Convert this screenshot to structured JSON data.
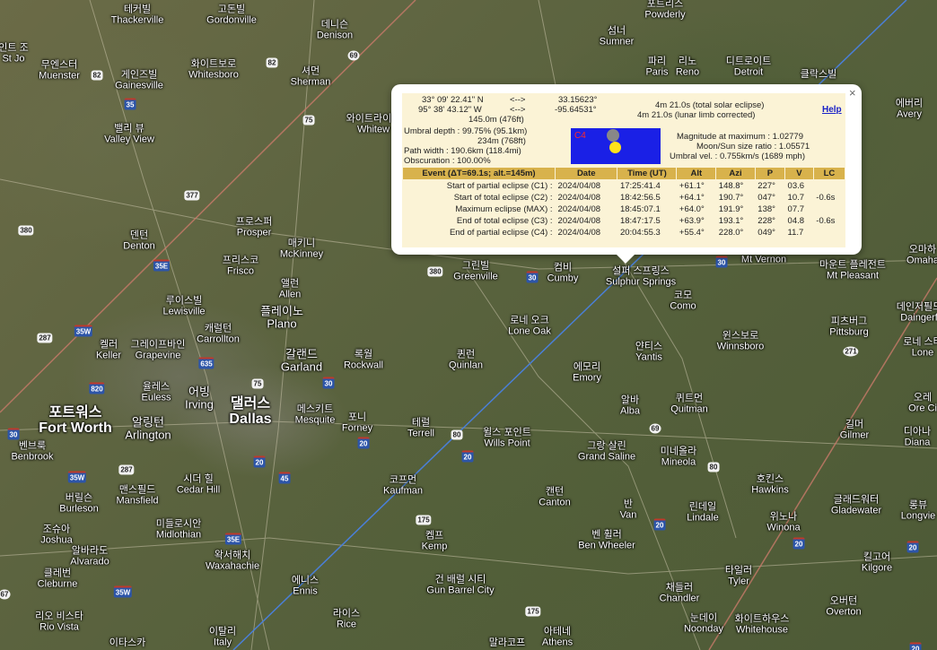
{
  "popup": {
    "coord_lat_dms": "33° 09' 22.41\" N",
    "coord_lon_dms": "95° 38' 43.12\" W",
    "arrow": "<-->",
    "coord_lat_dec": "33.15623°",
    "coord_lon_dec": "-95.64531°",
    "elevation": "145.0m (476ft)",
    "duration_total": "4m 21.0s (total solar eclipse)",
    "duration_limb": "4m 21.0s (lunar limb corrected)",
    "help": "Help",
    "umbral_depth": "Umbral depth : 99.75% (95.1km)",
    "umbral_depth_ft": "234m (768ft)",
    "path_width": "Path width : 190.6km (118.4mi)",
    "obscuration": "Obscuration : 100.00%",
    "sim_label": "C4",
    "magnitude": "Magnitude at maximum : 1.02779",
    "size_ratio": "Moon/Sun size ratio : 1.05571",
    "umbral_vel": "Umbral vel. : 0.755km/s (1689 mph)",
    "close": "×",
    "table": {
      "headers": [
        "Event (ΔT=69.1s; alt.=145m)",
        "Date",
        "Time (UT)",
        "Alt",
        "Azi",
        "P",
        "V",
        "LC"
      ],
      "rows": [
        [
          "Start of partial eclipse (C1) :",
          "2024/04/08",
          "17:25:41.4",
          "+61.1°",
          "148.8°",
          "227°",
          "03.6",
          ""
        ],
        [
          "Start of total eclipse (C2) :",
          "2024/04/08",
          "18:42:56.5",
          "+64.1°",
          "190.7°",
          "047°",
          "10.7",
          "-0.6s"
        ],
        [
          "Maximum eclipse (MAX) :",
          "2024/04/08",
          "18:45:07.1",
          "+64.0°",
          "191.9°",
          "138°",
          "07.7",
          ""
        ],
        [
          "End of total eclipse (C3) :",
          "2024/04/08",
          "18:47:17.5",
          "+63.9°",
          "193.1°",
          "228°",
          "04.8",
          "-0.6s"
        ],
        [
          "End of partial eclipse (C4) :",
          "2024/04/08",
          "20:04:55.3",
          "+55.4°",
          "228.0°",
          "049°",
          "11.7",
          ""
        ]
      ]
    }
  },
  "cities": [
    {
      "ko": "테커빌",
      "en": "Thackerville"
    },
    {
      "ko": "고돈빌",
      "en": "Gordonville"
    },
    {
      "ko": "데니슨",
      "en": "Denison"
    },
    {
      "ko": "포트리스",
      "en": "Powderly"
    },
    {
      "ko": "섬너",
      "en": "Sumner"
    },
    {
      "ko": "인트 조",
      "en": "St Jo"
    },
    {
      "ko": "무엔스터",
      "en": "Muenster"
    },
    {
      "ko": "게인즈빌",
      "en": "Gainesville"
    },
    {
      "ko": "화이트보로",
      "en": "Whitesboro"
    },
    {
      "ko": "셔먼",
      "en": "Sherman"
    },
    {
      "ko": "파리",
      "en": "Paris"
    },
    {
      "ko": "리노",
      "en": "Reno"
    },
    {
      "ko": "디트로이트",
      "en": "Detroit"
    },
    {
      "ko": "클락스빌",
      "en": ""
    },
    {
      "ko": "밸리 뷰",
      "en": "Valley View"
    },
    {
      "ko": "와이트라이트",
      "en": "Whitew"
    },
    {
      "ko": "에버리",
      "en": "Avery"
    },
    {
      "ko": "프로스퍼",
      "en": "Prosper"
    },
    {
      "ko": "덴턴",
      "en": "Denton"
    },
    {
      "ko": "매키니",
      "en": "McKinney"
    },
    {
      "ko": "프리스코",
      "en": "Frisco"
    },
    {
      "ko": "앨런",
      "en": "Allen"
    },
    {
      "ko": "그린빌",
      "en": "Greenville"
    },
    {
      "ko": "컴비",
      "en": "Cumby"
    },
    {
      "ko": "설퍼 스프링스",
      "en": "Sulphur Springs"
    },
    {
      "ko": "마운트 버넌",
      "en": "Mt Vernon"
    },
    {
      "ko": "마운트 플레전트",
      "en": "Mt Pleasant"
    },
    {
      "ko": "오마하",
      "en": "Omaha"
    },
    {
      "ko": "루이스빌",
      "en": "Lewisville"
    },
    {
      "ko": "플레이노",
      "en": "Plano"
    },
    {
      "ko": "캐럴턴",
      "en": "Carrollton"
    },
    {
      "ko": "로네 오크",
      "en": "Lone Oak"
    },
    {
      "ko": "코모",
      "en": "Como"
    },
    {
      "ko": "윈스보로",
      "en": "Winnsboro"
    },
    {
      "ko": "피츠버그",
      "en": "Pittsburg"
    },
    {
      "ko": "데인저필드",
      "en": "Daingerf"
    },
    {
      "ko": "켈러",
      "en": "Keller"
    },
    {
      "ko": "그레이프바인",
      "en": "Grapevine"
    },
    {
      "ko": "갈랜드",
      "en": "Garland"
    },
    {
      "ko": "록월",
      "en": "Rockwall"
    },
    {
      "ko": "퀸런",
      "en": "Quinlan"
    },
    {
      "ko": "얀티스",
      "en": "Yantis"
    },
    {
      "ko": "로네 스타",
      "en": "Lone"
    },
    {
      "ko": "율레스",
      "en": "Euless"
    },
    {
      "ko": "어빙",
      "en": "Irving"
    },
    {
      "ko": "댈러스",
      "en": "Dallas"
    },
    {
      "ko": "에모리",
      "en": "Emory"
    },
    {
      "ko": "알바",
      "en": "Alba"
    },
    {
      "ko": "퀴트먼",
      "en": "Quitman"
    },
    {
      "ko": "오레",
      "en": "Ore Ci"
    },
    {
      "ko": "포트워스",
      "en": "Fort Worth"
    },
    {
      "ko": "알링턴",
      "en": "Arlington"
    },
    {
      "ko": "메스키트",
      "en": "Mesquite"
    },
    {
      "ko": "포니",
      "en": "Forney"
    },
    {
      "ko": "테럴",
      "en": "Terrell"
    },
    {
      "ko": "윌스 포인트",
      "en": "Wills Point"
    },
    {
      "ko": "미네올라",
      "en": "Mineola"
    },
    {
      "ko": "길머",
      "en": "Gilmer"
    },
    {
      "ko": "디아나",
      "en": "Diana"
    },
    {
      "ko": "벤브룩",
      "en": "Benbrook"
    },
    {
      "ko": "그랑 살린",
      "en": "Grand Saline"
    },
    {
      "ko": "시더 힐",
      "en": "Cedar Hill"
    },
    {
      "ko": "코프먼",
      "en": "Kaufman"
    },
    {
      "ko": "맨스필드",
      "en": "Mansfield"
    },
    {
      "ko": "버릴슨",
      "en": "Burleson"
    },
    {
      "ko": "캔턴",
      "en": "Canton"
    },
    {
      "ko": "호킨스",
      "en": "Hawkins"
    },
    {
      "ko": "글래드워터",
      "en": "Gladewater"
    },
    {
      "ko": "롱뷰",
      "en": "Longvie"
    },
    {
      "ko": "린데일",
      "en": "Lindale"
    },
    {
      "ko": "반",
      "en": "Van"
    },
    {
      "ko": "조슈아",
      "en": "Joshua"
    },
    {
      "ko": "미들로시안",
      "en": "Midlothian"
    },
    {
      "ko": "위노나",
      "en": "Winona"
    },
    {
      "ko": "벤 휠러",
      "en": "Ben Wheeler"
    },
    {
      "ko": "켐프",
      "en": "Kemp"
    },
    {
      "ko": "알바라도",
      "en": "Alvarado"
    },
    {
      "ko": "왁서해치",
      "en": "Waxahachie"
    },
    {
      "ko": "킬고어",
      "en": "Kilgore"
    },
    {
      "ko": "클레번",
      "en": "Cleburne"
    },
    {
      "ko": "건 배럴 시티",
      "en": "Gun Barrel City"
    },
    {
      "ko": "타일러",
      "en": "Tyler"
    },
    {
      "ko": "에니스",
      "en": "Ennis"
    },
    {
      "ko": "채들러",
      "en": "Chandler"
    },
    {
      "ko": "오버턴",
      "en": "Overton"
    },
    {
      "ko": "리오 비스타",
      "en": "Rio Vista"
    },
    {
      "ko": "라이스",
      "en": "Rice"
    },
    {
      "ko": "눈데이",
      "en": "Noonday"
    },
    {
      "ko": "화이트하우스",
      "en": "Whitehouse"
    },
    {
      "ko": "이탈리",
      "en": "Italy"
    },
    {
      "ko": "아테네",
      "en": "Athens"
    },
    {
      "ko": "이타스카",
      "en": ""
    },
    {
      "ko": "말라코프",
      "en": ""
    }
  ],
  "shields": [
    "35",
    "82",
    "82",
    "69",
    "75",
    "377",
    "380",
    "35E",
    "380",
    "30",
    "30",
    "287",
    "35W",
    "635",
    "75",
    "30",
    "820",
    "80",
    "69",
    "271",
    "20",
    "30",
    "35W",
    "287",
    "20",
    "45",
    "20",
    "80",
    "175",
    "20",
    "35E",
    "20",
    "35W",
    "175",
    "67",
    "20",
    "20"
  ],
  "colors": {
    "path_line": "#4a7fd8",
    "limit_line": "#c97a6a",
    "popup_bg": "#fbf3d6",
    "table_header": "#d8b24c",
    "sim_bg": "#1a20e6",
    "sun": "#ffe21a",
    "help_link": "#1a22c8"
  }
}
